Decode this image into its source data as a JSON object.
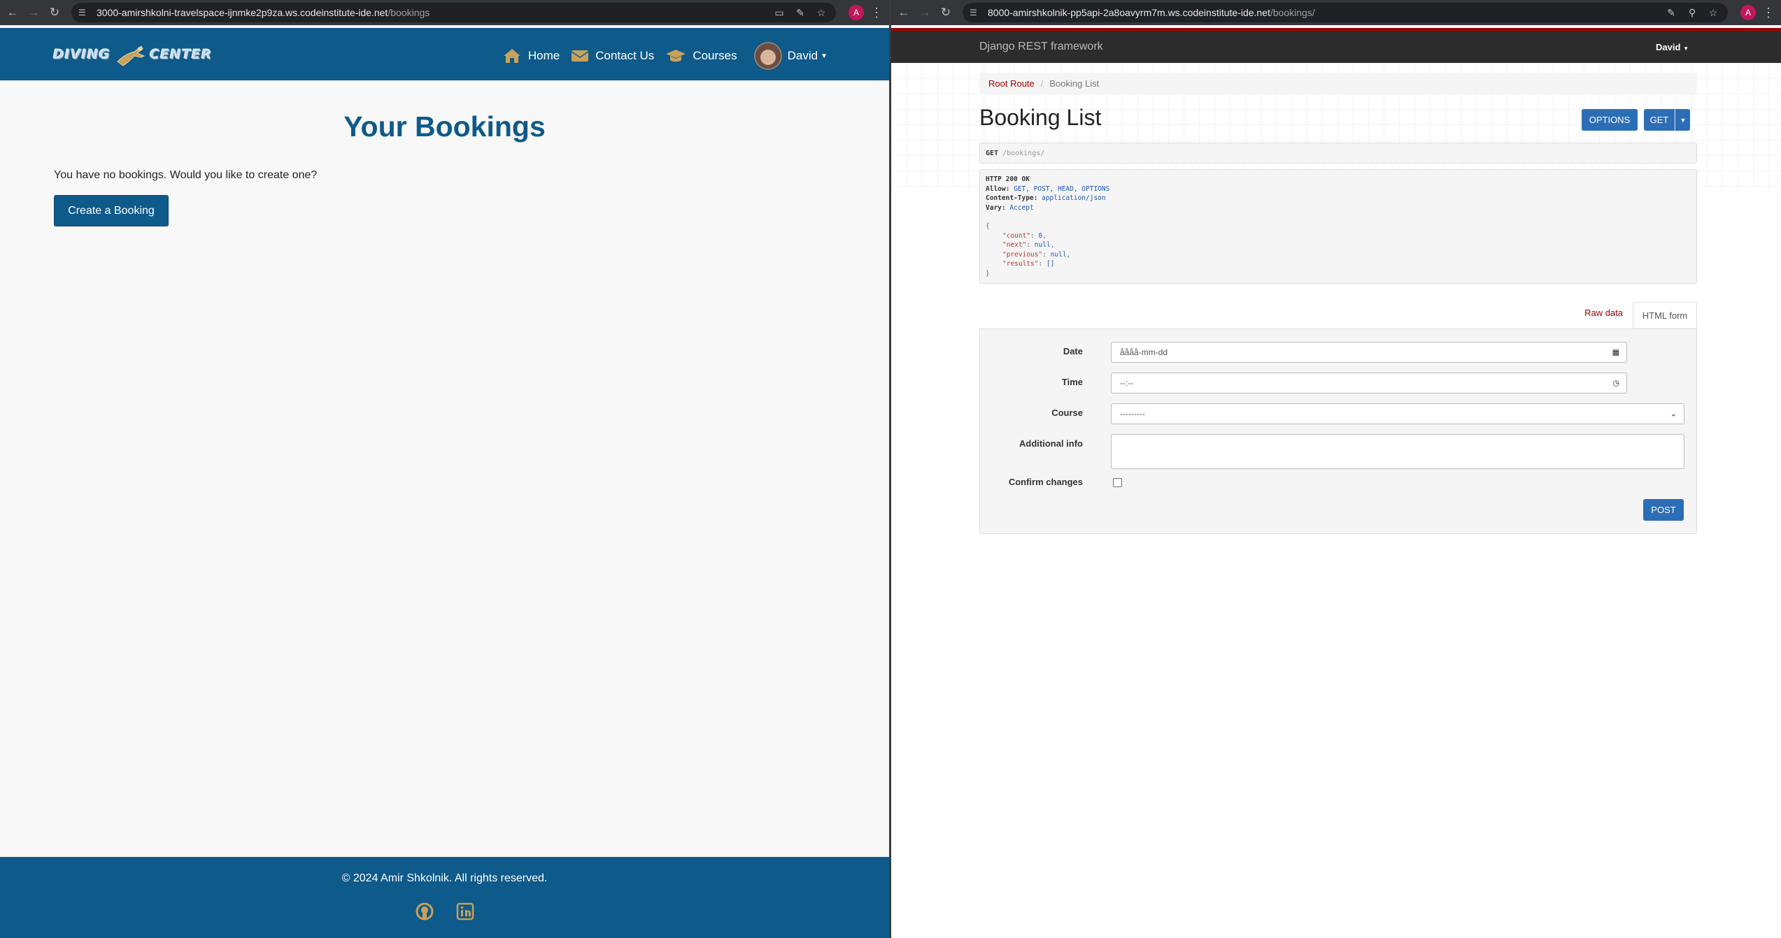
{
  "left_window": {
    "browser": {
      "url_host": "3000-amirshkolni-travelspace-ijnmke2p9za.ws.codeinstitute-ide.net",
      "url_path": "/bookings",
      "profile_initial": "A"
    },
    "navbar": {
      "logo_text_1": "DIVING",
      "logo_text_2": "CENTER",
      "items": [
        {
          "label": "Home",
          "icon": "home-icon"
        },
        {
          "label": "Contact Us",
          "icon": "envelope-icon"
        },
        {
          "label": "Courses",
          "icon": "graduation-cap-icon"
        }
      ],
      "user": "David"
    },
    "main": {
      "title": "Your Bookings",
      "empty_message": "You have no bookings. Would you like to create one?",
      "create_button": "Create a Booking"
    },
    "footer": {
      "copyright": "© 2024 Amir Shkolnik. All rights reserved.",
      "social": [
        "github-icon",
        "linkedin-icon"
      ]
    },
    "colors": {
      "brand": "#0e5a8a",
      "accent": "#c8a15a"
    }
  },
  "right_window": {
    "browser": {
      "url_host": "8000-amirshkolnik-pp5api-2a8oavyrm7m.ws.codeinstitute-ide.net",
      "url_path": "/bookings/",
      "profile_initial": "A"
    },
    "navbar": {
      "brand": "Django REST framework",
      "user": "David"
    },
    "breadcrumb": {
      "root": "Root Route",
      "separator": "/",
      "current": "Booking List"
    },
    "title": "Booking List",
    "buttons": {
      "options": "OPTIONS",
      "get": "GET"
    },
    "request": {
      "method": "GET",
      "path": "/bookings/"
    },
    "response": {
      "status": "HTTP 200 OK",
      "headers": [
        {
          "key": "Allow:",
          "value": "GET, POST, HEAD, OPTIONS"
        },
        {
          "key": "Content-Type:",
          "value": "application/json"
        },
        {
          "key": "Vary:",
          "value": "Accept"
        }
      ],
      "body": [
        {
          "key": "\"count\"",
          "value": "0",
          "punc": ","
        },
        {
          "key": "\"next\"",
          "value": "null",
          "punc": ","
        },
        {
          "key": "\"previous\"",
          "value": "null",
          "punc": ","
        },
        {
          "key": "\"results\"",
          "value": "[]",
          "punc": ""
        }
      ],
      "open_brace": "{",
      "close_brace": "}"
    },
    "tabs": {
      "raw": "Raw data",
      "html": "HTML form"
    },
    "form": {
      "fields": [
        {
          "label": "Date",
          "value": "åååå-mm-dd"
        },
        {
          "label": "Time",
          "value": "--:--"
        },
        {
          "label": "Course",
          "value": "---------"
        },
        {
          "label": "Additional info",
          "value": ""
        },
        {
          "label": "Confirm changes",
          "value": ""
        }
      ],
      "submit": "POST"
    },
    "colors": {
      "accent": "#a30000",
      "button": "#2c6eb6"
    }
  }
}
